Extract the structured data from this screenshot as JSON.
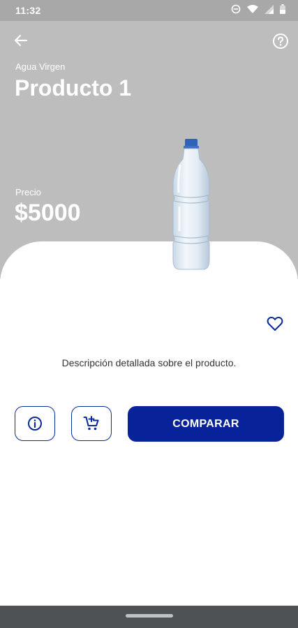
{
  "status_bar": {
    "time": "11:32"
  },
  "header": {
    "category": "Agua Virgen",
    "title": "Producto 1",
    "price_label": "Precio",
    "price_value": "$5000"
  },
  "product": {
    "description": "Descripción detallada sobre el producto."
  },
  "actions": {
    "compare_label": "COMPARAR"
  },
  "colors": {
    "header_bg": "#bdbdbd",
    "accent": "#08239a",
    "nav_bar": "#4f5254"
  },
  "icons": [
    "back-arrow-icon",
    "help-icon",
    "heart-icon",
    "info-icon",
    "add-to-cart-icon",
    "dnd-icon",
    "wifi-icon",
    "signal-icon",
    "battery-icon"
  ]
}
